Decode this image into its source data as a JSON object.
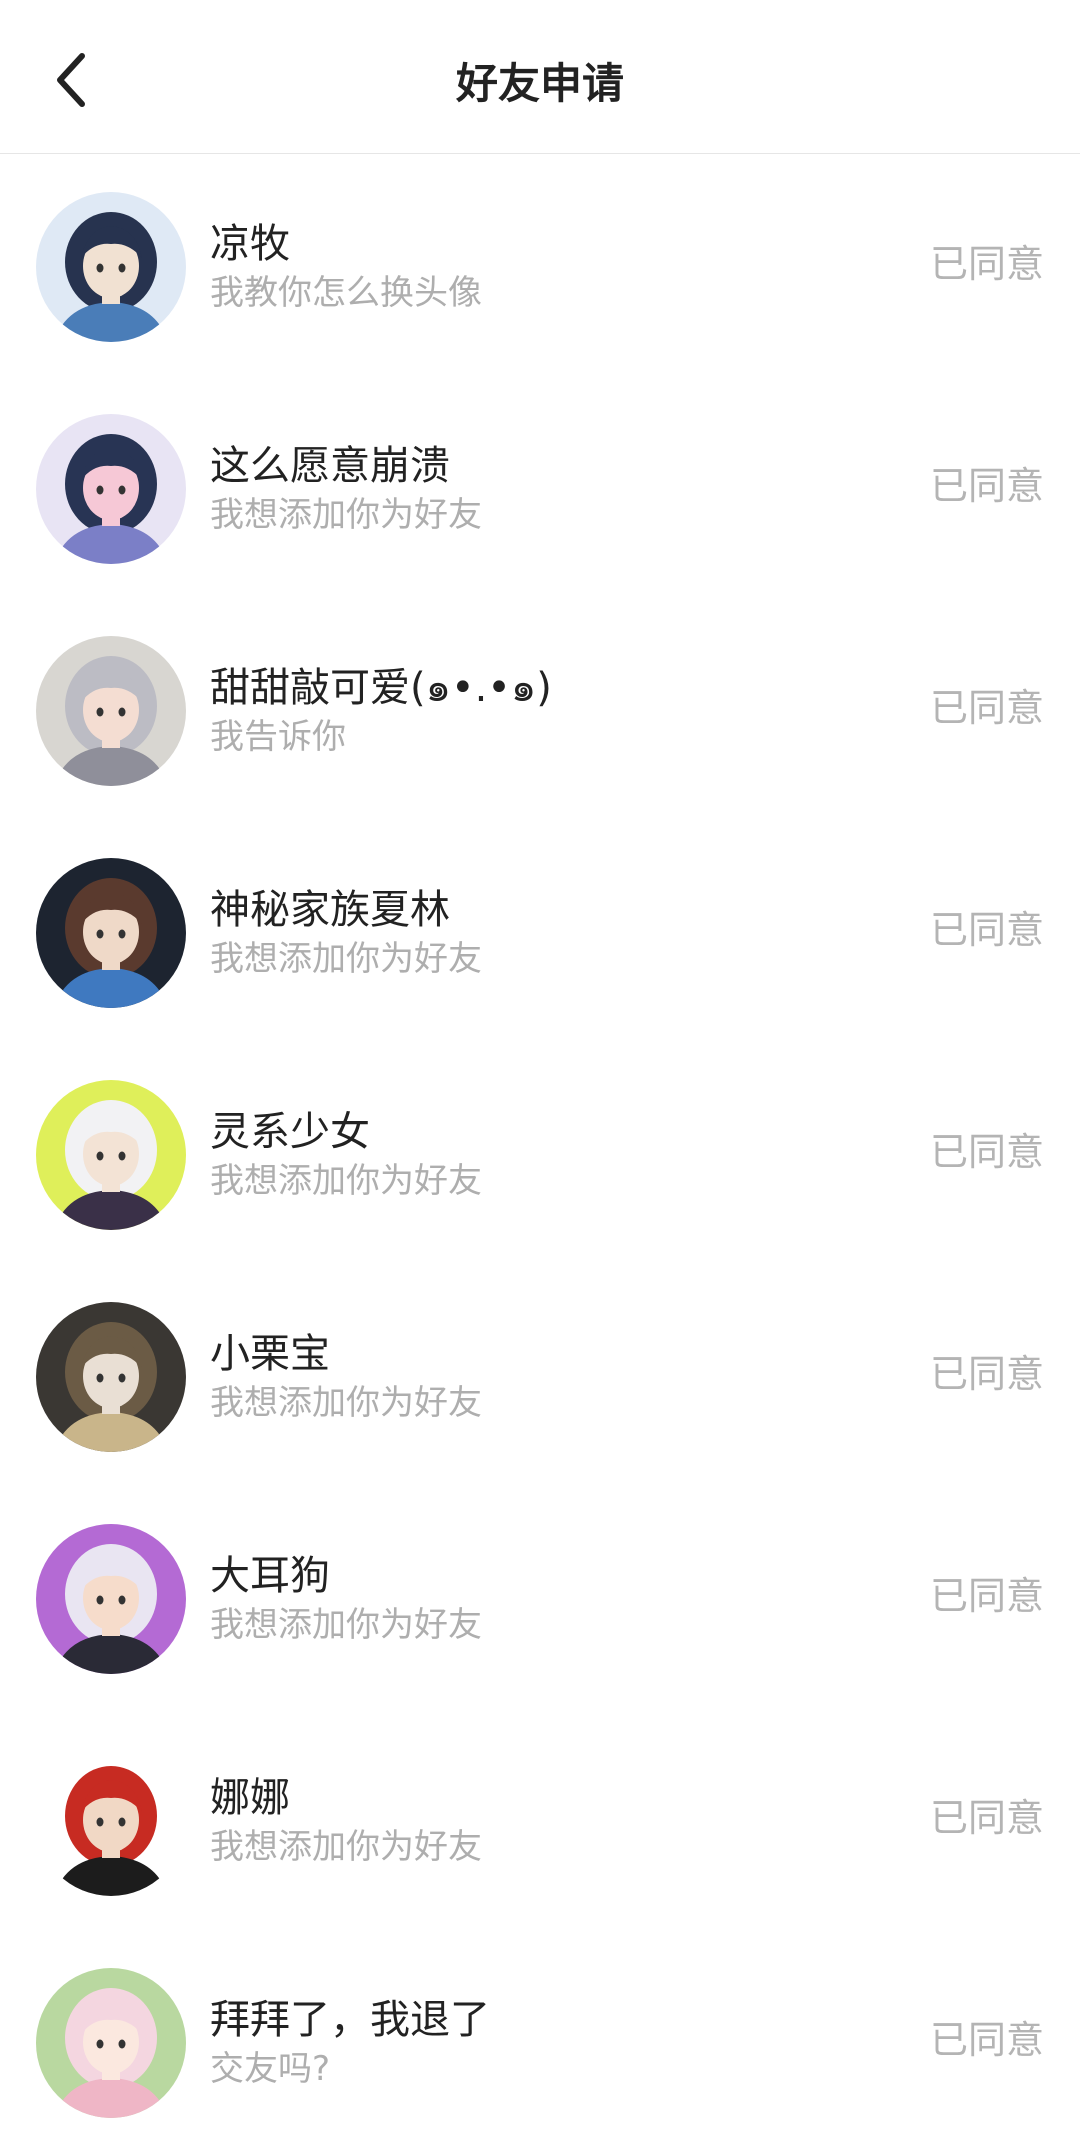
{
  "header": {
    "title": "好友申请",
    "back_icon": "chevron-left-icon"
  },
  "requests": [
    {
      "name": "凉牧",
      "message": "我教你怎么换头像",
      "status": "已同意",
      "avatar_colors": [
        "#dfe9f5",
        "#27334f",
        "#4a7db8",
        "#f1e1d2"
      ]
    },
    {
      "name": "这么愿意崩溃",
      "message": "我想添加你为好友",
      "status": "已同意",
      "avatar_colors": [
        "#e8e4f4",
        "#283454",
        "#7b7fc7",
        "#f6c8d6"
      ]
    },
    {
      "name": "甜甜敲可爱(๑•.•๑)",
      "message": "我告诉你",
      "status": "已同意",
      "avatar_colors": [
        "#d8d6d1",
        "#bcbcc4",
        "#8f8f9a",
        "#f4ddd2"
      ]
    },
    {
      "name": "神秘家族夏林",
      "message": "我想添加你为好友",
      "status": "已同意",
      "avatar_colors": [
        "#1d2430",
        "#5a3a2e",
        "#3f79c0",
        "#efd9c8"
      ]
    },
    {
      "name": "灵系少女",
      "message": "我想添加你为好友",
      "status": "已同意",
      "avatar_colors": [
        "#dfef5a",
        "#f2f2f4",
        "#3a3048",
        "#f3e3d5"
      ]
    },
    {
      "name": "小栗宝",
      "message": "我想添加你为好友",
      "status": "已同意",
      "avatar_colors": [
        "#3a3733",
        "#6b5b45",
        "#c9b58a",
        "#e9dfd4"
      ]
    },
    {
      "name": "大耳狗",
      "message": "我想添加你为好友",
      "status": "已同意",
      "avatar_colors": [
        "#b46ad4",
        "#e9e5f2",
        "#2a2a36",
        "#f6dccb"
      ]
    },
    {
      "name": "娜娜",
      "message": "我想添加你为好友",
      "status": "已同意",
      "avatar_colors": [
        "#ffffff",
        "#c72b22",
        "#1c1c1c",
        "#f1d8c5"
      ]
    },
    {
      "name": "拜拜了，我退了",
      "message": "交友吗?",
      "status": "已同意",
      "avatar_colors": [
        "#b9d8a0",
        "#f4d6e0",
        "#efb6c6",
        "#fbe8df"
      ]
    }
  ]
}
